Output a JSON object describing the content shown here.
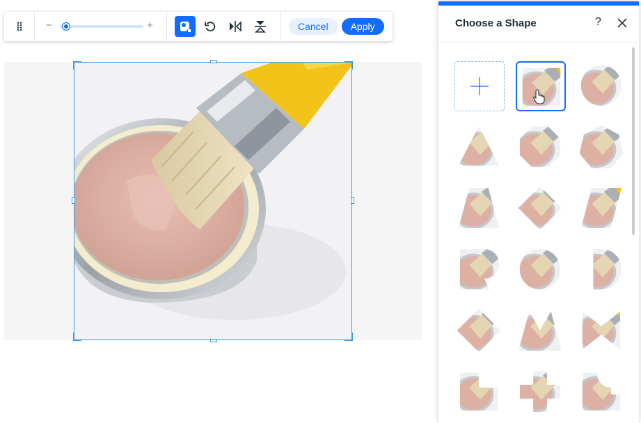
{
  "toolbar": {
    "zoom_minus": "−",
    "zoom_plus": "+",
    "zoom_level": 0.05,
    "cancel_label": "Cancel",
    "apply_label": "Apply"
  },
  "panel": {
    "title": "Choose a Shape",
    "help_label": "?",
    "shapes": [
      "add-custom-shape",
      "square",
      "circle",
      "triangle",
      "octagon",
      "heptagon",
      "trapezoid",
      "diamond",
      "parallelogram",
      "rounded-tab-right",
      "circle-notch",
      "half-circle-right",
      "diamond-cut",
      "double-triangle",
      "bowtie-right",
      "stepped-corner",
      "cross",
      "rounded-corner-cut"
    ]
  },
  "colors": {
    "accent": "#116dff",
    "accent_light": "#e7f0ff",
    "selection": "#3899ec"
  }
}
